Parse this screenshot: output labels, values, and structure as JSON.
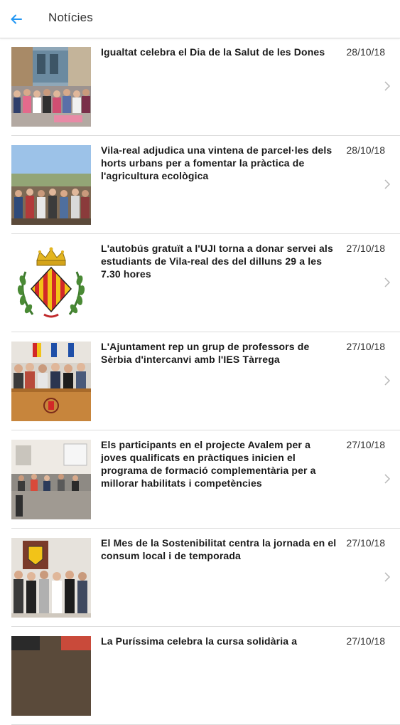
{
  "header": {
    "title": "Notícies",
    "back_icon": "arrow-left-icon",
    "accent": "#2196f3"
  },
  "news": [
    {
      "title": "Igualtat celebra el Dia de la Salut de les Dones",
      "date": "28/10/18",
      "image": "group-photo-plaza"
    },
    {
      "title": "Vila-real adjudica una vintena de parcel·les dels horts urbans per a fomentar la pràctica de l'agricultura ecològica",
      "date": "28/10/18",
      "image": "group-photo-garden"
    },
    {
      "title": "L'autobús gratuït a l'UJI torna a donar servei als estudiants de Vila-real des del dilluns 29 a les 7.30 hores",
      "date": "27/10/18",
      "image": "coat-of-arms"
    },
    {
      "title": "L'Ajuntament rep un grup de professors de Sèrbia d'intercanvi amb l'IES Tàrrega",
      "date": "27/10/18",
      "image": "meeting-photo-council"
    },
    {
      "title": "Els participants en el projecte Avalem per a joves qualificats en pràctiques inicien el programa de formació complementària per a millorar habilitats i competències",
      "date": "27/10/18",
      "image": "classroom-photo"
    },
    {
      "title": "El Mes de la Sostenibilitat centra la jornada en el consum local i de temporada",
      "date": "27/10/18",
      "image": "group-photo-hall"
    },
    {
      "title": "La Puríssima celebra la cursa solidària a",
      "date": "27/10/18",
      "image": "event-photo"
    }
  ]
}
